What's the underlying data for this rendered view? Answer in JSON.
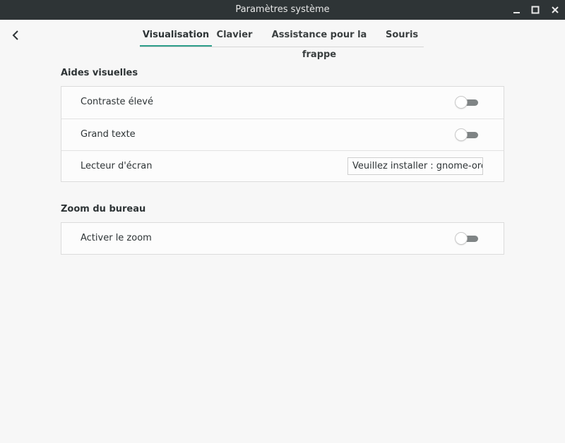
{
  "window": {
    "title": "Paramètres système"
  },
  "tabs": [
    {
      "label": "Visualisation",
      "active": true
    },
    {
      "label": "Clavier",
      "active": false
    },
    {
      "label": "Assistance pour la frappe",
      "active": false
    },
    {
      "label": "Souris",
      "active": false
    }
  ],
  "visual_aids": {
    "heading": "Aides visuelles",
    "rows": [
      {
        "label": "Contraste élevé",
        "control": "toggle",
        "value": false
      },
      {
        "label": "Grand texte",
        "control": "toggle",
        "value": false
      },
      {
        "label": "Lecteur d'écran",
        "control": "button",
        "button_label": "Veuillez installer : gnome-orca"
      }
    ]
  },
  "zoom": {
    "heading": "Zoom du bureau",
    "rows": [
      {
        "label": "Activer le zoom",
        "control": "toggle",
        "value": false
      }
    ]
  },
  "colors": {
    "titlebar": "#2e3436",
    "accent": "#2e9e8a",
    "switch_off": "#7f8485"
  },
  "icons": {
    "back": "chevron-left-icon",
    "minimize": "minimize-icon",
    "maximize": "maximize-icon",
    "close": "close-icon"
  }
}
